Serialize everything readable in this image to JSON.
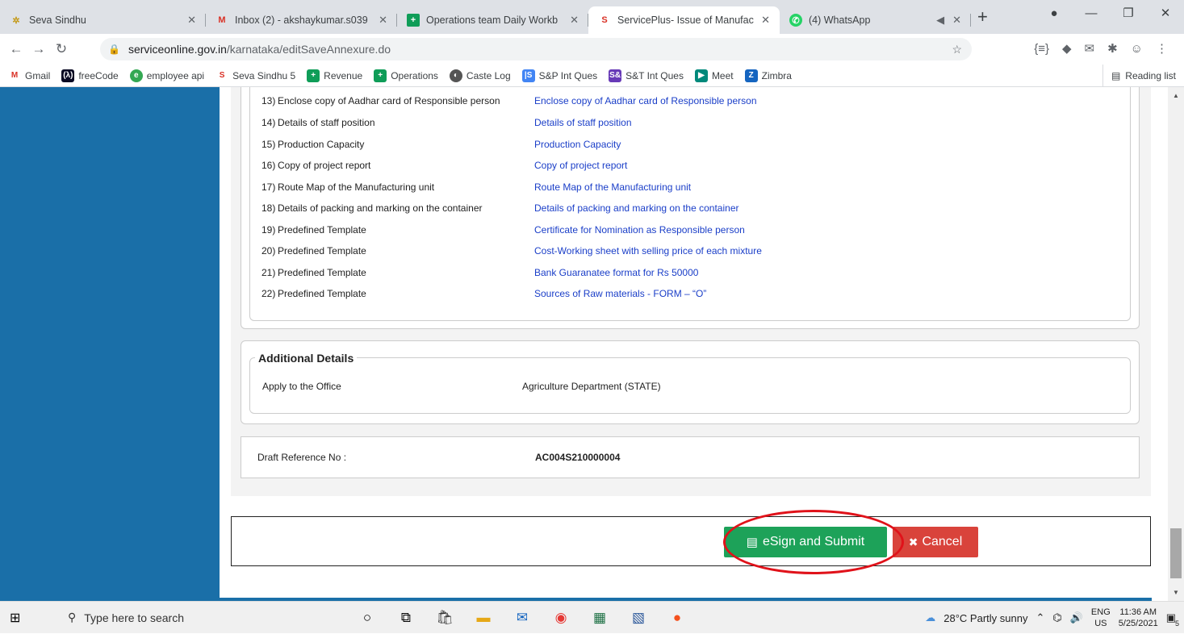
{
  "tabs": [
    {
      "title": "Seva Sindhu",
      "icon": "seva-sindhu-icon"
    },
    {
      "title": "Inbox (2) - akshaykumar.s039",
      "icon": "gmail-icon"
    },
    {
      "title": "Operations team Daily Workb",
      "icon": "sheets-icon"
    },
    {
      "title": "ServicePlus- Issue of Manufac",
      "icon": "serviceplus-icon"
    },
    {
      "title": "(4) WhatsApp",
      "icon": "whatsapp-icon"
    }
  ],
  "address": {
    "domain": "serviceonline.gov.in",
    "path": "/karnataka/editSaveAnnexure.do"
  },
  "bookmarks": [
    "Gmail",
    "freeCode",
    "employee api",
    "Seva Sindhu 5",
    "Revenue",
    "Operations",
    "Caste Log",
    "S&P Int Ques",
    "S&T Int Ques",
    "Meet",
    "Zimbra"
  ],
  "reading_list": "Reading list",
  "documents": [
    {
      "num": "13)",
      "desc": "Enclose copy of Aadhar card of Responsible person",
      "link": "Enclose copy of Aadhar card of Responsible person"
    },
    {
      "num": "14)",
      "desc": "Details of staff position",
      "link": "Details of staff position"
    },
    {
      "num": "15)",
      "desc": "Production Capacity",
      "link": "Production Capacity"
    },
    {
      "num": "16)",
      "desc": "Copy of project report",
      "link": "Copy of project report"
    },
    {
      "num": "17)",
      "desc": "Route Map of the Manufacturing unit",
      "link": "Route Map of the Manufacturing unit"
    },
    {
      "num": "18)",
      "desc": "Details of packing and marking on the container",
      "link": "Details of packing and marking on the container"
    },
    {
      "num": "19)",
      "desc": "Predefined Template",
      "link": "Certificate for Nomination as Responsible person"
    },
    {
      "num": "20)",
      "desc": "Predefined Template",
      "link": "Cost-Working sheet with selling price of each mixture"
    },
    {
      "num": "21)",
      "desc": "Predefined Template",
      "link": "Bank Guaranatee format for Rs 50000"
    },
    {
      "num": "22)",
      "desc": "Predefined Template",
      "link": "Sources of Raw materials - FORM – “O”"
    }
  ],
  "additional": {
    "title": "Additional Details",
    "label": "Apply to the Office",
    "value": "Agriculture Department (STATE)"
  },
  "draft": {
    "label": "Draft Reference No :",
    "value": "AC004S210000004"
  },
  "buttons": {
    "esign": "eSign and Submit",
    "cancel": "Cancel"
  },
  "taskbar": {
    "search": "Type here to search",
    "weather": "28°C  Partly sunny",
    "lang1": "ENG",
    "lang2": "US",
    "time": "11:36 AM",
    "date": "5/25/2021",
    "notif": "5"
  }
}
